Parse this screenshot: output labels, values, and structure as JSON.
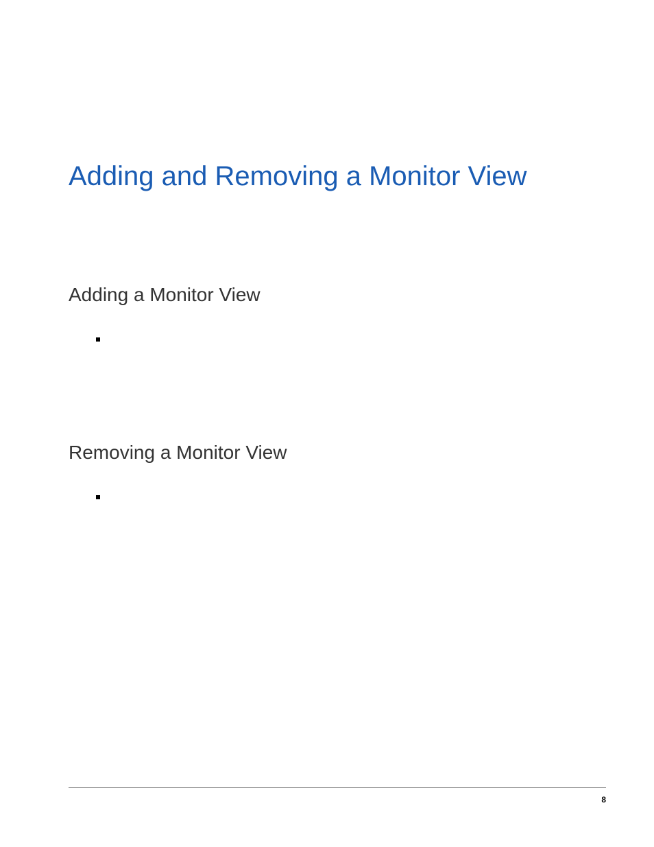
{
  "title": "Adding and Removing a Monitor View",
  "sections": [
    {
      "heading": "Adding a Monitor View"
    },
    {
      "heading": "Removing a Monitor View"
    }
  ],
  "pageNumber": "8"
}
